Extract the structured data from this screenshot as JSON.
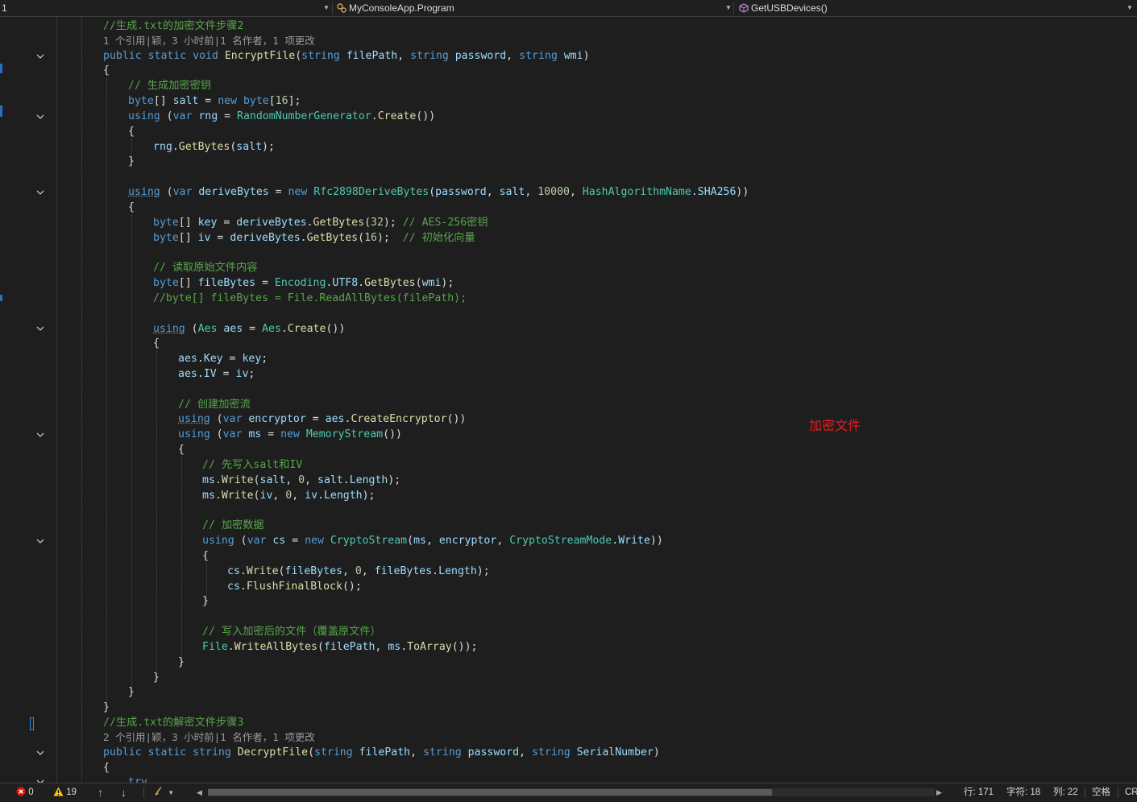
{
  "topbar": {
    "left_fragment": "1",
    "class_name": "MyConsoleApp.Program",
    "member_name": "GetUSBDevices()"
  },
  "annotation": "加密文件",
  "code": {
    "l1_comment": "//生成.txt的加密文件步骤2",
    "l2_lens": "1 个引用|颖，3 小时前|1 名作者，1 项更改",
    "l20_comment": "// 写入加密后的文件（覆盖原文件）",
    "l31_comment": "//生成.txt的解密文件步骤3",
    "l32_lens": "2 个引用|颖，3 小时前|1 名作者，1 项更改"
  },
  "statusbar": {
    "errors": "0",
    "warnings": "19",
    "line": "行: 171",
    "char": "字符: 18",
    "col": "列: 22",
    "indent": "空格",
    "eol": "CR"
  }
}
